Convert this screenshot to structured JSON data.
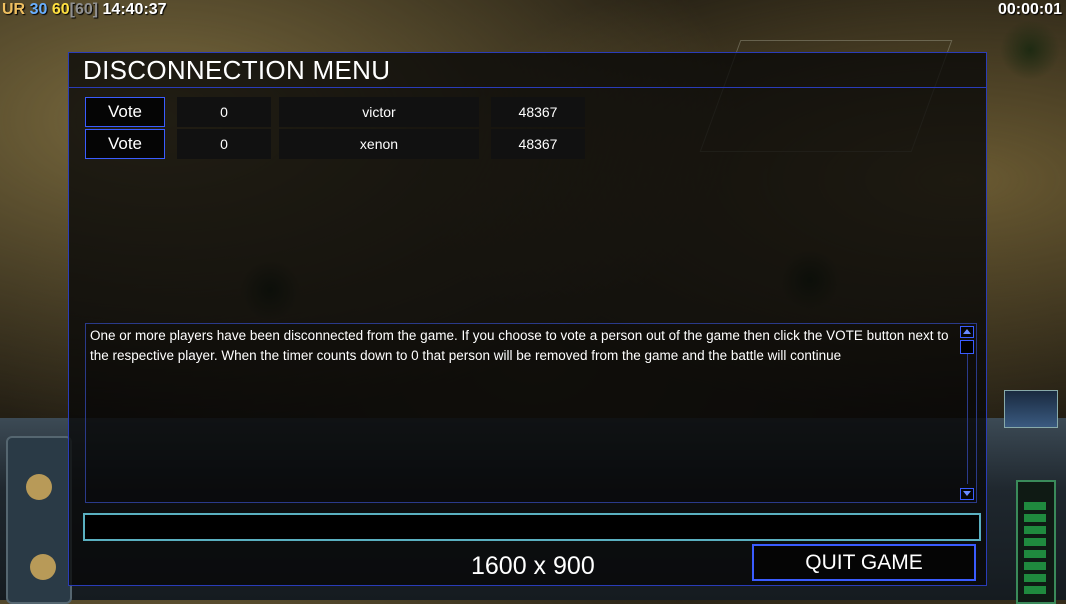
{
  "hud": {
    "top_left": {
      "prefix": "UR",
      "fps_a": "30",
      "fps_b": "60",
      "fps_c": "[60]",
      "clock": "14:40:37"
    },
    "top_right_timer": "00:00:01"
  },
  "dialog": {
    "title": "DISCONNECTION MENU",
    "players": [
      {
        "vote_label": "Vote",
        "votes": "0",
        "name": "victor",
        "ping": "48367"
      },
      {
        "vote_label": "Vote",
        "votes": "0",
        "name": "xenon",
        "ping": "48367"
      }
    ],
    "message": "One or more players have been disconnected from the game. If you choose to vote a person out of the game then click the VOTE button next to the respective player. When the timer counts down to 0 that person will be removed from the game and the battle will continue",
    "chat_value": "",
    "resolution": "1600 x 900",
    "quit_label": "QUIT GAME"
  },
  "colors": {
    "dialog_border": "#2a3cb8",
    "button_border": "#3a5cff",
    "chat_border": "#5ab0c0"
  }
}
